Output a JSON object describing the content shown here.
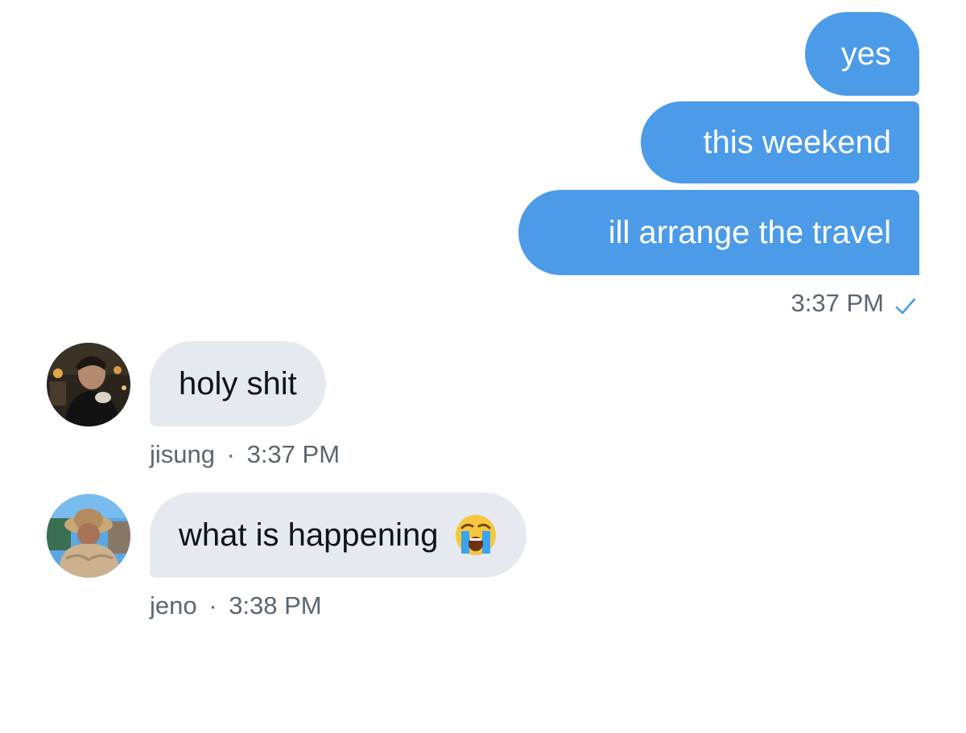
{
  "sent_messages": [
    {
      "text": "yes"
    },
    {
      "text": "this weekend"
    },
    {
      "text": "ill arrange the travel"
    }
  ],
  "sent_meta": {
    "time": "3:37 PM",
    "status_icon": "checkmark-icon"
  },
  "received_messages": [
    {
      "text": "holy shit",
      "sender": "jisung",
      "time": "3:37 PM",
      "separator": "·"
    },
    {
      "text": "what is happening",
      "sender": "jeno",
      "time": "3:38 PM",
      "separator": "·",
      "emoji": "loudly-crying-face-emoji"
    }
  ],
  "colors": {
    "sent_bubble": "#4c9be8",
    "received_bubble": "#e6e9ef",
    "meta_text": "#5b6671",
    "check": "#4c9be8"
  }
}
